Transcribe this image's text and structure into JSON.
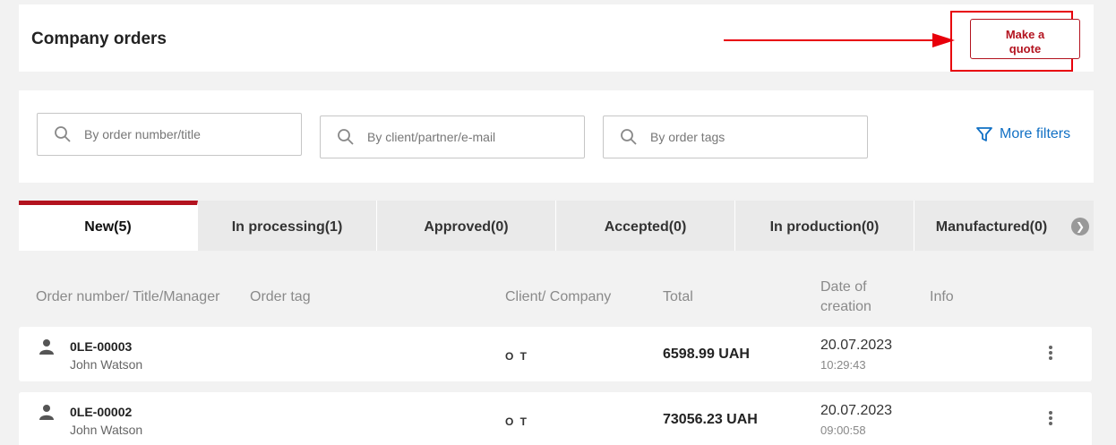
{
  "header": {
    "title": "Company orders",
    "quote_button": "Make a\nquote",
    "highlight_color": "#e8000b"
  },
  "filters": {
    "order_search": {
      "placeholder": "By order number/title",
      "icon": "search-icon"
    },
    "client_search": {
      "placeholder": "By client/partner/e-mail",
      "icon": "search-icon"
    },
    "tag_search": {
      "placeholder": "By order tags",
      "icon": "search-icon"
    },
    "more_filters": {
      "label": "More filters",
      "icon": "filter-icon"
    }
  },
  "tabs": [
    {
      "label": "New(5)",
      "active": true
    },
    {
      "label": "In processing(1)"
    },
    {
      "label": "Approved(0)"
    },
    {
      "label": "Accepted(0)"
    },
    {
      "label": "In production(0)"
    },
    {
      "label": "Manufactured(0)"
    }
  ],
  "columns": {
    "order": "Order number/ Title/Manager",
    "tag": "Order tag",
    "client": "Client/ Company",
    "total": "Total",
    "date": "Date of creation",
    "info": "Info"
  },
  "orders": [
    {
      "number": "0LE-00003",
      "manager": "John Watson",
      "client": "O T",
      "total": "6598.99 UAH",
      "date": "20.07.2023",
      "time": "10:29:43"
    },
    {
      "number": "0LE-00002",
      "manager": "John Watson",
      "client": "O T",
      "total": "73056.23 UAH",
      "date": "20.07.2023",
      "time": "09:00:58"
    }
  ],
  "colors": {
    "accent": "#b3131f",
    "link": "#1170c4"
  }
}
